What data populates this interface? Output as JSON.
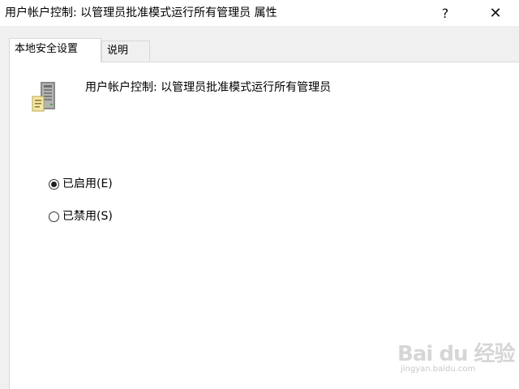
{
  "window": {
    "title": "用户帐户控制: 以管理员批准模式运行所有管理员 属性",
    "help_glyph": "?",
    "close_glyph": "✕"
  },
  "tabs": [
    {
      "label": "本地安全设置",
      "selected": true
    },
    {
      "label": "说明",
      "selected": false
    }
  ],
  "policy": {
    "icon": "server-policy-icon",
    "title": "用户帐户控制: 以管理员批准模式运行所有管理员"
  },
  "options": [
    {
      "label": "已启用(E)",
      "checked": true
    },
    {
      "label": "已禁用(S)",
      "checked": false
    }
  ],
  "watermark": {
    "main": "Bai du 经验",
    "sub": "jingyan.baidu.com"
  }
}
